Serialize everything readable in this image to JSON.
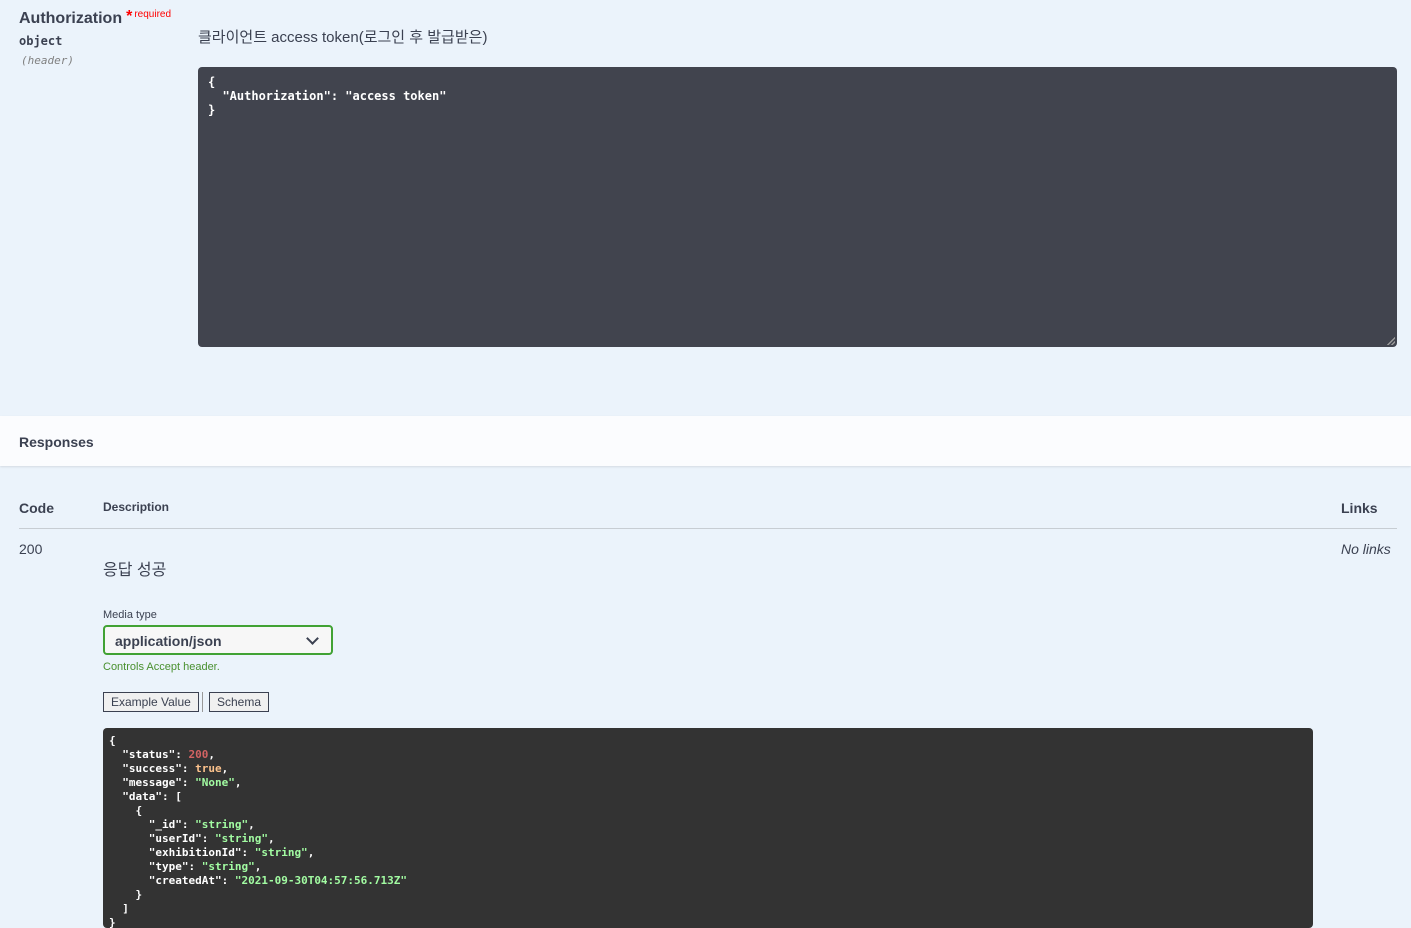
{
  "parameter": {
    "name": "Authorization",
    "required_star": "*",
    "required_label": "required",
    "type": "object",
    "location": "(header)",
    "description": "클라이언트 access token(로그인 후 발급받은)",
    "value_lines": [
      "{",
      "  \"Authorization\": \"access token\"",
      "}"
    ]
  },
  "responses": {
    "title": "Responses",
    "columns": {
      "code": "Code",
      "description": "Description",
      "links": "Links"
    },
    "rows": [
      {
        "code": "200",
        "description": "응답 성공",
        "links": "No links",
        "media_type_label": "Media type",
        "media_type_selected": "application/json",
        "media_type_note": "Controls Accept header.",
        "tabs": [
          "Example Value",
          "Schema"
        ],
        "example": {
          "status": "200",
          "success": "true",
          "message": "\"None\"",
          "data_item": {
            "_id": "\"string\"",
            "userId": "\"string\"",
            "exhibitionId": "\"string\"",
            "type": "\"string\"",
            "createdAt": "\"2021-09-30T04:57:56.713Z\""
          }
        }
      }
    ]
  },
  "colors": {
    "background": "#ebf3fb",
    "code_block": "#41444e",
    "example_block": "#333333",
    "required": "#ff0000",
    "select_border": "#41a234",
    "json_number": "#d36363",
    "json_bool": "#fcc28c",
    "json_string": "#a2fca2"
  },
  "icons": [
    "chevron-down-icon"
  ]
}
